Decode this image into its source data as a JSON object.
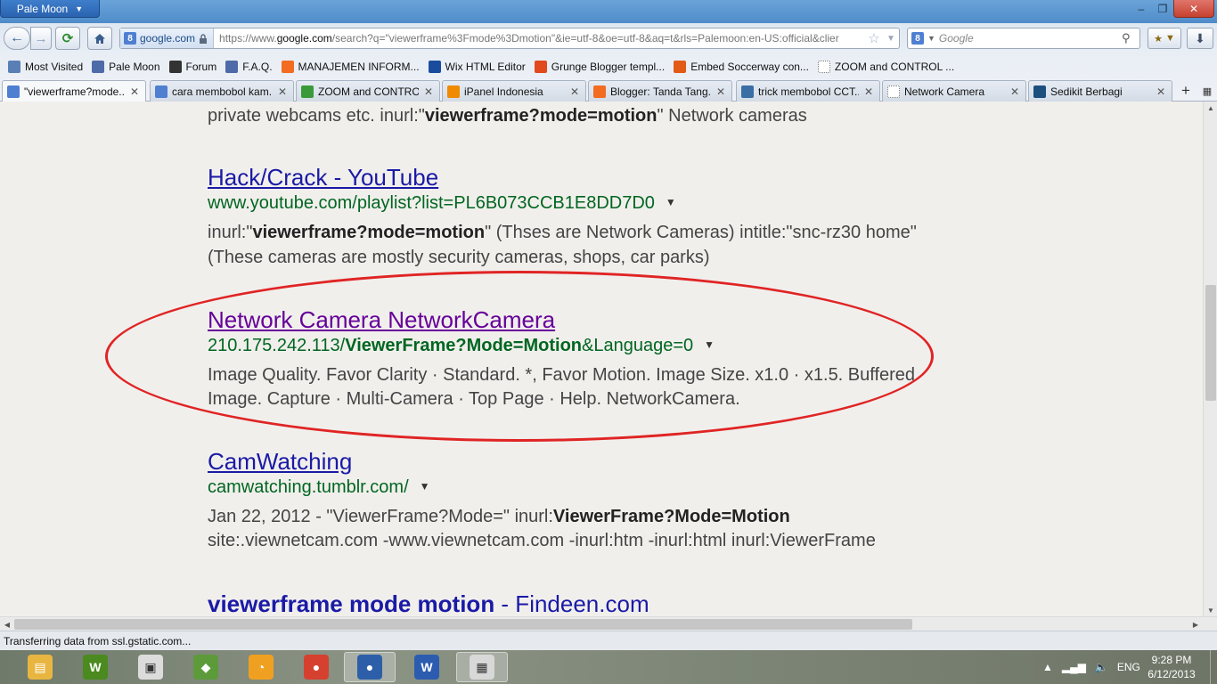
{
  "window": {
    "app_button": "Pale Moon",
    "minimize": "–",
    "maximize": "❐",
    "close": "✕"
  },
  "nav": {
    "site_identity": "google.com",
    "url_prefix": "https://www.",
    "url_domain": "google.com",
    "url_rest": "/search?q=\"viewerframe%3Fmode%3Dmotion\"&ie=utf-8&oe=utf-8&aq=t&rls=Palemoon:en-US:official&clier",
    "search_placeholder": "Google"
  },
  "bookmarks": [
    {
      "label": "Most Visited",
      "icon": "most-visited-icon",
      "color": "#5a7fb5"
    },
    {
      "label": "Pale Moon",
      "icon": "pale-moon-icon",
      "color": "#4e6aa8"
    },
    {
      "label": "Forum",
      "icon": "forum-icon",
      "color": "#333333"
    },
    {
      "label": "F.A.Q.",
      "icon": "faq-icon",
      "color": "#4e6aa8"
    },
    {
      "label": "MANAJEMEN INFORM...",
      "icon": "blogger-icon",
      "color": "#f26c22"
    },
    {
      "label": "Wix HTML Editor",
      "icon": "wix-icon",
      "color": "#1a4c9e"
    },
    {
      "label": "Grunge Blogger templ...",
      "icon": "et-icon",
      "color": "#e04a1c"
    },
    {
      "label": "Embed Soccerway con...",
      "icon": "soccerway-icon",
      "color": "#e35a16"
    },
    {
      "label": "ZOOM and CONTROL ...",
      "icon": "page-icon",
      "color": "#ffffff"
    }
  ],
  "tabs": [
    {
      "label": "\"viewerframe?mode...",
      "icon": "google-icon",
      "color": "#4f7fd1",
      "active": true
    },
    {
      "label": "cara membobol kam...",
      "icon": "google-icon",
      "color": "#4f7fd1",
      "active": false
    },
    {
      "label": "ZOOM and CONTRO...",
      "icon": "loading-icon",
      "color": "#3a9a3a",
      "active": false
    },
    {
      "label": "iPanel Indonesia",
      "icon": "ipanel-icon",
      "color": "#f08a00",
      "active": false
    },
    {
      "label": "Blogger: Tanda Tang...",
      "icon": "blogger-icon",
      "color": "#f26c22",
      "active": false
    },
    {
      "label": "trick membobol CCT...",
      "icon": "wordpress-icon",
      "color": "#3a6ea5",
      "active": false
    },
    {
      "label": "Network Camera",
      "icon": "page-icon",
      "color": "#ffffff",
      "active": false
    },
    {
      "label": "Sedikit Berbagi",
      "icon": "blog-icon",
      "color": "#1c4e7e",
      "active": false
    }
  ],
  "results": {
    "top_snippet": {
      "pre": "private webcams etc. inurl:\"",
      "bold": "viewerframe?mode=motion",
      "post": "\" Network cameras"
    },
    "r1": {
      "title": "Hack/Crack - YouTube",
      "url": "www.youtube.com/playlist?list=PL6B073CCB1E8DD7D0",
      "line1_pre": "inurl:\"",
      "line1_bold": "viewerframe?mode=motion",
      "line1_post": "\" (Thses are Network Cameras) intitle:\"snc-rz30 home\"",
      "line2": "(These cameras are mostly security cameras, shops, car parks)"
    },
    "r2": {
      "title": "Network Camera NetworkCamera",
      "url_pre": "210.175.242.113/",
      "url_bold": "ViewerFrame?Mode=Motion",
      "url_post": "&Language=0",
      "line1": "Image Quality. Favor Clarity · Standard. *, Favor Motion. Image Size. x1.0 · x1.5. Buffered",
      "line2": "Image. Capture · Multi-Camera · Top Page · Help. NetworkCamera."
    },
    "r3": {
      "title": "CamWatching",
      "url": "camwatching.tumblr.com/",
      "line1_pre": "Jan 22, 2012 - \"ViewerFrame?Mode=\" inurl:",
      "line1_bold": "ViewerFrame?Mode=Motion",
      "line2": "site:.viewnetcam.com -www.viewnetcam.com -inurl:htm -inurl:html inurl:ViewerFrame"
    },
    "r4": {
      "title_bold": "viewerframe mode motion",
      "title_rest": " - Findeen.com"
    }
  },
  "status": "Transferring data from ssl.gstatic.com...",
  "taskbar": {
    "apps": [
      {
        "name": "file-explorer-icon",
        "color": "#e8b640",
        "glyph": "▤"
      },
      {
        "name": "winamp-icon",
        "color": "#4a8a1e",
        "glyph": "W"
      },
      {
        "name": "app-store-icon",
        "color": "#dcdcdc",
        "glyph": "▣"
      },
      {
        "name": "evernote-icon",
        "color": "#5d9b3a",
        "glyph": "◆"
      },
      {
        "name": "speedometer-icon",
        "color": "#f0a020",
        "glyph": "◔"
      },
      {
        "name": "chrome-icon",
        "color": "#d6412f",
        "glyph": "●"
      },
      {
        "name": "pale-moon-icon",
        "color": "#2d5fa8",
        "glyph": "●"
      },
      {
        "name": "word-icon",
        "color": "#2b5cb0",
        "glyph": "W"
      },
      {
        "name": "window-icon",
        "color": "#d8d8d8",
        "glyph": "▦"
      }
    ],
    "language": "ENG",
    "time": "9:28 PM",
    "date": "6/12/2013"
  }
}
